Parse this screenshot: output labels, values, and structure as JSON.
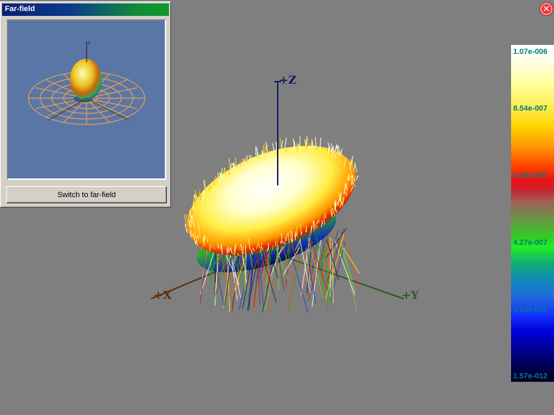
{
  "panel": {
    "title": "Far-field",
    "switch_label": "Switch to far-field",
    "preview_axis_label": "z"
  },
  "axes": {
    "z_label": "+Z",
    "x_label": "+X",
    "y_label": "+Y"
  },
  "colorbar": {
    "labels": [
      "1.07e-006",
      "8.54e-007",
      "6.40e-007",
      "4.27e-007",
      "2.13e-007",
      "1.57e-012"
    ],
    "max": 1.07e-06,
    "min": 1.57e-12
  },
  "close_icon": "close-icon",
  "colors": {
    "background": "#7f7f7f",
    "z_axis": "#0b1f5c",
    "x_axis": "#5a2d10",
    "y_axis": "#2e5a1a",
    "colorbar_text": "#007f7f"
  }
}
